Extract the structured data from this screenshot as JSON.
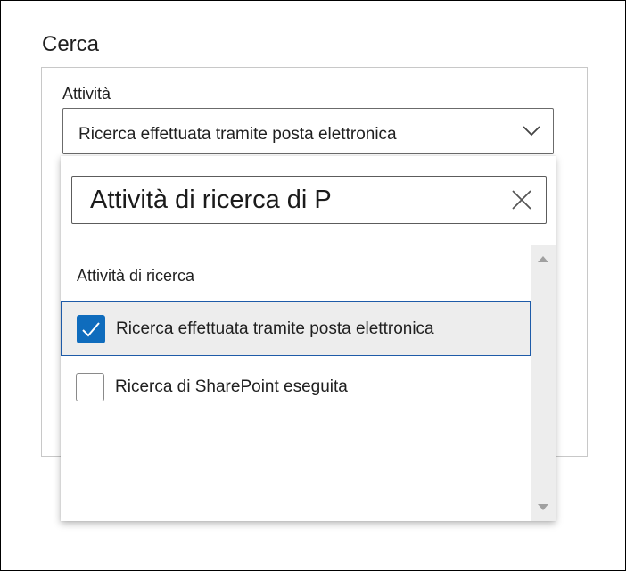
{
  "section": {
    "title": "Cerca"
  },
  "activity_field": {
    "label": "Attività",
    "selected_value": "Ricerca effettuata tramite posta elettronica"
  },
  "dropdown": {
    "search_value": "Attività di ricerca di P",
    "group_header": "Attività di ricerca",
    "options": [
      {
        "label": "Ricerca effettuata tramite posta elettronica",
        "checked": true
      },
      {
        "label": "Ricerca di SharePoint eseguita",
        "checked": false
      }
    ]
  },
  "icons": {
    "chevron": "chevron-down-icon",
    "clear": "close-icon",
    "check": "checkmark-icon",
    "scroll_up": "scroll-up-arrow-icon",
    "scroll_down": "scroll-down-arrow-icon"
  },
  "colors": {
    "accent": "#0f6cbd",
    "selected_border": "#1e5ba8",
    "selected_bg": "#ededed"
  }
}
